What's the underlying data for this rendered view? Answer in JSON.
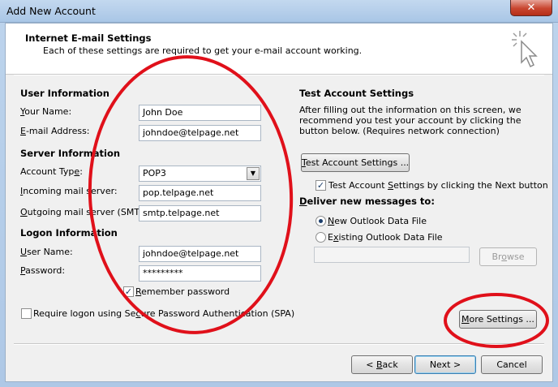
{
  "window": {
    "title": "Add New Account",
    "close_label": "✕"
  },
  "header": {
    "title": "Internet E-mail Settings",
    "subtitle": "Each of these settings are required to get your e-mail account working."
  },
  "user_info": {
    "heading": "User Information",
    "name_label_u": "Y",
    "name_label_rest": "our Name:",
    "name_value": "John Doe",
    "email_label_u": "E",
    "email_label_rest": "-mail Address:",
    "email_value": "johndoe@telpage.net"
  },
  "server_info": {
    "heading": "Server Information",
    "account_type_label_pre": "Account Typ",
    "account_type_label_u": "e",
    "account_type_label_post": ":",
    "account_type_value": "POP3",
    "incoming_label_u": "I",
    "incoming_label_rest": "ncoming mail server:",
    "incoming_value": "pop.telpage.net",
    "outgoing_label_u": "O",
    "outgoing_label_rest": "utgoing mail server (SMTP):",
    "outgoing_value": "smtp.telpage.net"
  },
  "logon_info": {
    "heading": "Logon Information",
    "username_label_u": "U",
    "username_label_rest": "ser Name:",
    "username_value": "johndoe@telpage.net",
    "password_label_u": "P",
    "password_label_rest": "assword:",
    "password_value": "*********",
    "remember_u": "R",
    "remember_rest": "emember password",
    "remember_checked": "✓",
    "spa_pre": "Require logon using Se",
    "spa_u": "c",
    "spa_post": "ure Password Authentication (SPA)"
  },
  "test_settings": {
    "heading": "Test Account Settings",
    "description": "After filling out the information on this screen, we recommend you test your account by clicking the button below. (Requires network connection)",
    "button_u": "T",
    "button_rest": "est Account Settings ...",
    "auto_test_checked": "✓",
    "auto_test_pre": "Test Account ",
    "auto_test_u": "S",
    "auto_test_post": "ettings by clicking the Next button",
    "deliver_heading_pre": "",
    "deliver_heading_u": "D",
    "deliver_heading_post": "eliver new messages to:",
    "new_pst_u": "N",
    "new_pst_rest": "ew Outlook Data File",
    "existing_pst_pre": "E",
    "existing_pst_u": "x",
    "existing_pst_post": "isting Outlook Data File",
    "browse_label_pre": "Br",
    "browse_label_u": "o",
    "browse_label_post": "wse",
    "more_settings_u": "M",
    "more_settings_rest": "ore Settings ..."
  },
  "footer": {
    "back_pre": "< ",
    "back_u": "B",
    "back_post": "ack",
    "next_label": "Next >",
    "cancel_label": "Cancel"
  },
  "colors": {
    "annotation": "#e0101a",
    "title_gradient_top": "#c3d8ef",
    "close_red": "#c8452f"
  }
}
